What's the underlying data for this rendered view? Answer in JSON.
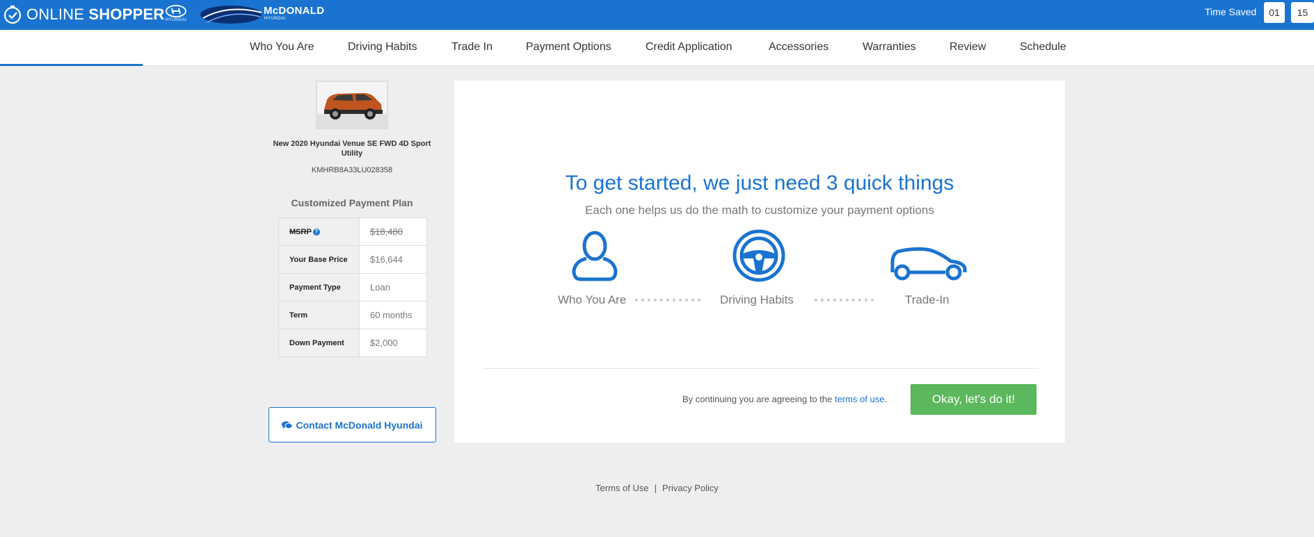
{
  "header": {
    "brand_light": "ONLINE ",
    "brand_bold": "SHOPPER",
    "make_logo_text": "HYUNDAI",
    "dealer_name": "McDONALD",
    "dealer_sub": "HYUNDAI",
    "time_saved_label": "Time Saved",
    "time_minutes": "01",
    "time_separator": ":",
    "time_seconds": "15",
    "accent_color": "#1a73d0"
  },
  "nav": {
    "items": [
      {
        "label": "Who You Are"
      },
      {
        "label": "Driving Habits"
      },
      {
        "label": "Trade In"
      },
      {
        "label": "Payment Options"
      },
      {
        "label": "Credit Application"
      },
      {
        "label": "Accessories"
      },
      {
        "label": "Warranties"
      },
      {
        "label": "Review"
      },
      {
        "label": "Schedule"
      }
    ]
  },
  "vehicle": {
    "title": "New 2020 Hyundai Venue SE FWD 4D Sport Utility",
    "vin": "KMHRB8A33LU028358",
    "color": "#c0541f"
  },
  "payment_plan": {
    "title": "Customized Payment Plan",
    "rows": [
      {
        "label": "MSRP",
        "value": "$18,480"
      },
      {
        "label": "Your Base Price",
        "value": "$16,644"
      },
      {
        "label": "Payment Type",
        "value": "Loan"
      },
      {
        "label": "Term",
        "value": "60 months"
      },
      {
        "label": "Down Payment",
        "value": "$2,000"
      }
    ]
  },
  "contact": {
    "label": "Contact McDonald Hyundai"
  },
  "intro": {
    "headline": "To get started, we just need 3 quick things",
    "subline": "Each one helps us do the math to customize your payment options",
    "steps": [
      {
        "label": "Who You Are",
        "icon": "person-icon"
      },
      {
        "label": "Driving Habits",
        "icon": "steering-wheel-icon"
      },
      {
        "label": "Trade-In",
        "icon": "car-icon"
      }
    ],
    "agree_text": "By continuing you are agreeing to the ",
    "agree_link": "terms of use",
    "agree_end": ".",
    "button_label": "Okay, let's do it!",
    "button_color": "#5cb85c"
  },
  "footer": {
    "terms": "Terms of Use",
    "separator": "|",
    "privacy": "Privacy Policy"
  }
}
